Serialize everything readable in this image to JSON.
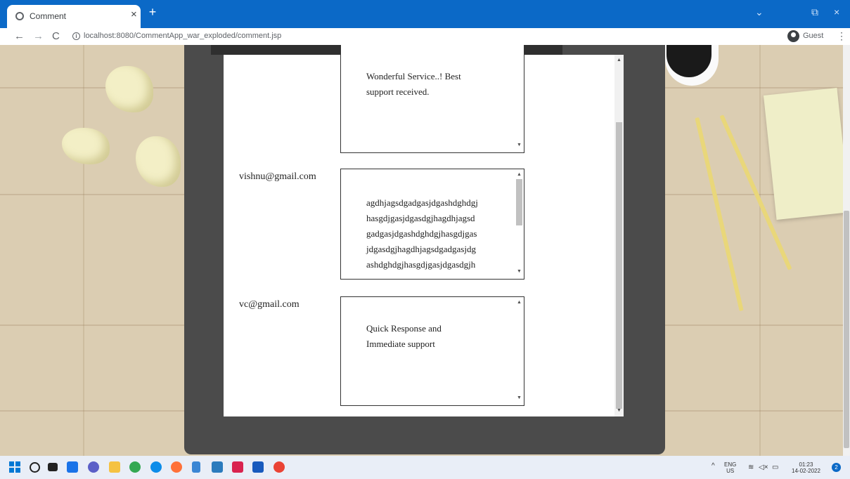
{
  "browser": {
    "tab_title": "Comment",
    "tab_close": "×",
    "new_tab": "+",
    "url": "localhost:8080/CommentApp_war_exploded/comment.jsp",
    "profile_label": "Guest",
    "kebab": "⋮",
    "back": "←",
    "forward": "→",
    "reload": "C",
    "minimize": "⌄",
    "restore": "⧉",
    "close": "×",
    "accent_color": "#0b69c7"
  },
  "comments": [
    {
      "email": "",
      "text": "Wonderful Service..! Best\nsupport received."
    },
    {
      "email": "vishnu@gmail.com",
      "text": "agdhjagsdgadgasjdgashdghdgj\nhasgdjgasjdgasdgjhagdhjagsd\ngadgasjdgashdghdgjhasgdjgas\njdgasdgjhagdhjagsdgadgasjdg\nashdghdgjhasgdjgasjdgasdgjh"
    },
    {
      "email": "vc@gmail.com",
      "text": "Quick Response and\nImmediate support"
    }
  ],
  "taskbar": {
    "lang_top": "ENG",
    "lang_bottom": "US",
    "time": "01:23",
    "date": "14-02-2022",
    "notification_count": "2",
    "apps": [
      "start-icon",
      "search-icon",
      "task-view-icon",
      "widgets-icon",
      "chat-icon",
      "file-explorer-icon",
      "chrome-icon",
      "edge-icon",
      "firefox-icon",
      "notepad-icon",
      "snipping-tool-icon",
      "intellij-icon",
      "word-icon",
      "chrome-guest-icon"
    ]
  }
}
